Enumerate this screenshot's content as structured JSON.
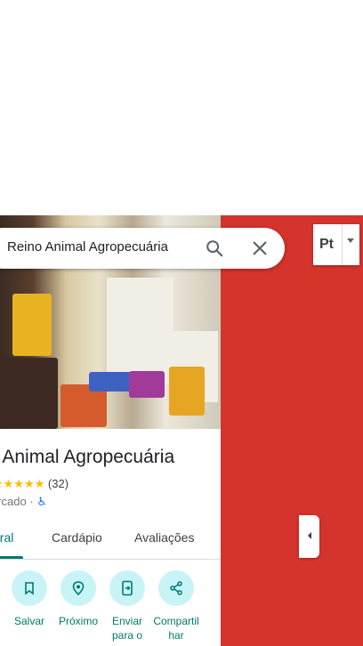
{
  "search": {
    "query": "Reino Animal Agropecuária"
  },
  "place": {
    "title": "o Animal Agropecuária",
    "stars": "★★★★★",
    "review_count": "(32)",
    "category": "ercado ·",
    "accessibility_icon": "wheelchair-icon"
  },
  "tabs": [
    {
      "label": "eral",
      "active": true
    },
    {
      "label": "Cardápio",
      "active": false
    },
    {
      "label": "Avaliações",
      "active": false
    }
  ],
  "actions": [
    {
      "label": "Salvar",
      "icon": "bookmark-icon"
    },
    {
      "label": "Próximo",
      "icon": "nearby-icon"
    },
    {
      "label": "Enviar para o",
      "icon": "send-to-phone-icon"
    },
    {
      "label": "Compartilhar",
      "icon": "share-icon"
    }
  ],
  "layer_button": {
    "label": "Pt"
  },
  "colors": {
    "accent": "#00796b",
    "action_bg": "#c8f4f8",
    "map_bg": "#d4342c"
  }
}
